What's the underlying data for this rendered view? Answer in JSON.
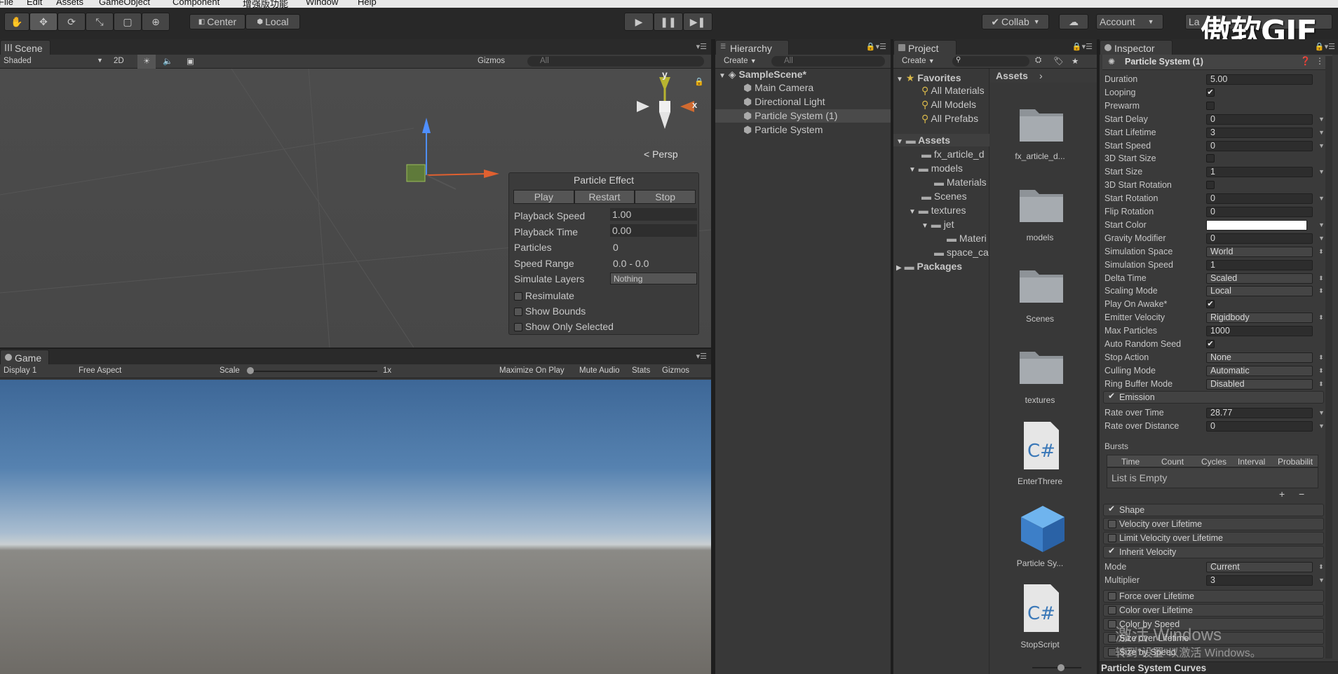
{
  "menu": [
    "File",
    "Edit",
    "Assets",
    "GameObject",
    "Component",
    "增强版功能",
    "Window",
    "Help"
  ],
  "toolbar": {
    "center_label": "Center",
    "local_label": "Local",
    "collab_label": "Collab",
    "account_label": "Account",
    "layers_label": "La",
    "watermark": "傲软GIF"
  },
  "scene": {
    "tab": "Scene",
    "shading": "Shaded",
    "mode_2d": "2D",
    "gizmos": "Gizmos",
    "search": "All",
    "persp": "Persp",
    "axis_y": "y",
    "axis_x": "x"
  },
  "particle_effect": {
    "title": "Particle Effect",
    "play": "Play",
    "restart": "Restart",
    "stop": "Stop",
    "rows": [
      {
        "label": "Playback Speed",
        "value": "1.00"
      },
      {
        "label": "Playback Time",
        "value": "0.00"
      },
      {
        "label": "Particles",
        "value": "0"
      },
      {
        "label": "Speed Range",
        "value": "0.0 - 0.0"
      },
      {
        "label": "Simulate Layers",
        "value": "Nothing"
      }
    ],
    "checks": [
      "Resimulate",
      "Show Bounds",
      "Show Only Selected"
    ]
  },
  "game": {
    "tab": "Game",
    "display": "Display 1",
    "aspect": "Free Aspect",
    "scale_label": "Scale",
    "scale_value": "1x",
    "options": [
      "Maximize On Play",
      "Mute Audio",
      "Stats",
      "Gizmos"
    ]
  },
  "hierarchy": {
    "tab": "Hierarchy",
    "create": "Create",
    "search": "All",
    "scene": "SampleScene*",
    "items": [
      "Main Camera",
      "Directional Light",
      "Particle System (1)",
      "Particle System"
    ]
  },
  "project": {
    "tab": "Project",
    "create": "Create",
    "favorites": "Favorites",
    "fav_items": [
      "All Materials",
      "All Models",
      "All Prefabs"
    ],
    "assets": "Assets",
    "tree": [
      "fx_article_d",
      "models",
      "Materials",
      "Scenes",
      "textures",
      "jet",
      "Materi",
      "space_ca"
    ],
    "packages": "Packages",
    "breadcrumb": "Assets",
    "grid_items": [
      "fx_article_d...",
      "models",
      "Scenes",
      "textures",
      "EnterThrere",
      "Particle Sy...",
      "StopScript"
    ]
  },
  "inspector": {
    "tab": "Inspector",
    "title": "Particle System (1)",
    "props": [
      {
        "l": "Duration",
        "v": "5.00",
        "t": "val"
      },
      {
        "l": "Looping",
        "v": "true",
        "t": "chk"
      },
      {
        "l": "Prewarm",
        "v": "false",
        "t": "chk"
      },
      {
        "l": "Start Delay",
        "v": "0",
        "t": "drop"
      },
      {
        "l": "Start Lifetime",
        "v": "3",
        "t": "drop"
      },
      {
        "l": "Start Speed",
        "v": "0",
        "t": "drop"
      },
      {
        "l": "3D Start Size",
        "v": "false",
        "t": "chk"
      },
      {
        "l": "Start Size",
        "v": "1",
        "t": "drop"
      },
      {
        "l": "3D Start Rotation",
        "v": "false",
        "t": "chk"
      },
      {
        "l": "Start Rotation",
        "v": "0",
        "t": "drop"
      },
      {
        "l": "Flip Rotation",
        "v": "0",
        "t": "val"
      },
      {
        "l": "Start Color",
        "v": "",
        "t": "color"
      },
      {
        "l": "Gravity Modifier",
        "v": "0",
        "t": "drop"
      },
      {
        "l": "Simulation Space",
        "v": "World",
        "t": "sel"
      },
      {
        "l": "Simulation Speed",
        "v": "1",
        "t": "val"
      },
      {
        "l": "Delta Time",
        "v": "Scaled",
        "t": "sel"
      },
      {
        "l": "Scaling Mode",
        "v": "Local",
        "t": "sel"
      },
      {
        "l": "Play On Awake*",
        "v": "true",
        "t": "chk"
      },
      {
        "l": "Emitter Velocity",
        "v": "Rigidbody",
        "t": "sel"
      },
      {
        "l": "Max Particles",
        "v": "1000",
        "t": "val"
      },
      {
        "l": "Auto Random Seed",
        "v": "true",
        "t": "chk"
      },
      {
        "l": "Stop Action",
        "v": "None",
        "t": "sel"
      },
      {
        "l": "Culling Mode",
        "v": "Automatic",
        "t": "sel"
      },
      {
        "l": "Ring Buffer Mode",
        "v": "Disabled",
        "t": "sel"
      }
    ],
    "emission": {
      "label": "Emission",
      "rate_time_label": "Rate over Time",
      "rate_time": "28.77",
      "rate_dist_label": "Rate over Distance",
      "rate_dist": "0",
      "bursts": "Bursts",
      "cols": [
        "Time",
        "Count",
        "Cycles",
        "Interval",
        "Probabilit"
      ],
      "empty": "List is Empty"
    },
    "modules": [
      {
        "l": "Shape",
        "on": true
      },
      {
        "l": "Velocity over Lifetime",
        "on": false
      },
      {
        "l": "Limit Velocity over Lifetime",
        "on": false
      },
      {
        "l": "Inherit Velocity",
        "on": true
      }
    ],
    "inherit": {
      "mode_label": "Mode",
      "mode": "Current",
      "mult_label": "Multiplier",
      "mult": "3"
    },
    "modules2": [
      "Force over Lifetime",
      "Color over Lifetime",
      "Color by Speed",
      "Size over Lifetime",
      "Size by Speed"
    ],
    "curves": "Particle System Curves",
    "activate": "激活 Windows",
    "activate_sub": "转到\"设置\"以激活 Windows。"
  },
  "colors": {
    "accent": "#3e5f96",
    "sky_top": "#3e6a9a",
    "ground": "#6b6762"
  }
}
